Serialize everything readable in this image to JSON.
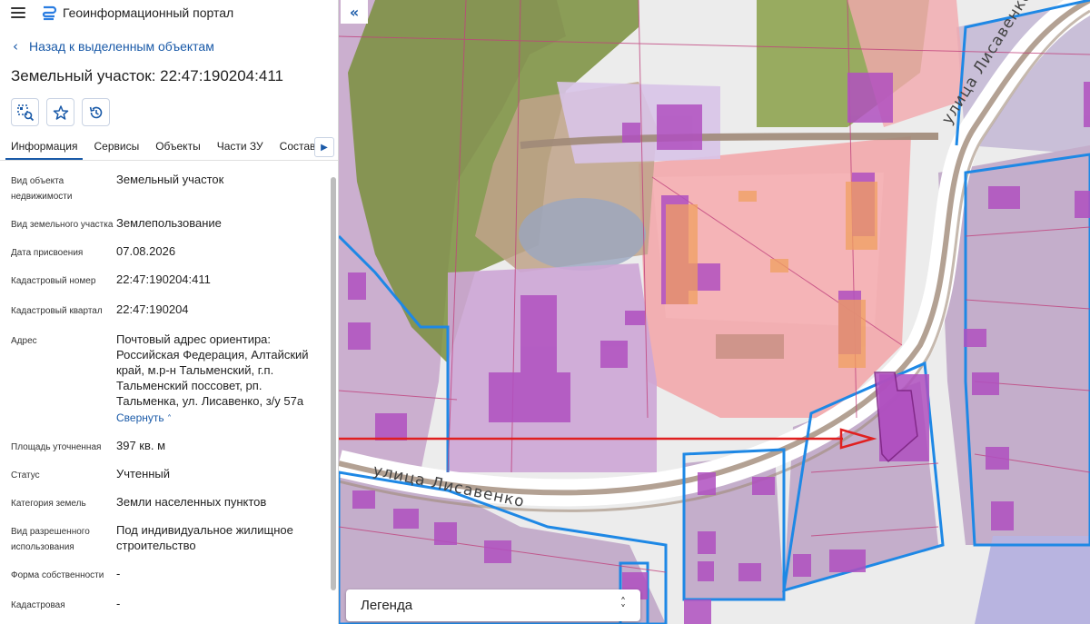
{
  "app": {
    "title": "Геоинформационный портал"
  },
  "nav": {
    "back_label": "Назад к выделенным объектам"
  },
  "object": {
    "title": "Земельный участок: 22:47:190204:411"
  },
  "actions": [
    {
      "name": "locate-icon"
    },
    {
      "name": "star-icon"
    },
    {
      "name": "history-icon"
    }
  ],
  "tabs": [
    {
      "label": "Информация",
      "active": true
    },
    {
      "label": "Сервисы"
    },
    {
      "label": "Объекты"
    },
    {
      "label": "Части ЗУ"
    },
    {
      "label": "Состав"
    }
  ],
  "properties": [
    {
      "key": "Вид объекта недвижимости",
      "value": "Земельный участок"
    },
    {
      "key": "Вид земельного участка",
      "value": "Землепользование"
    },
    {
      "key": "Дата присвоения",
      "value": "07.08.2026"
    },
    {
      "key": "Кадастровый номер",
      "value": "22:47:190204:411"
    },
    {
      "key": "Кадастровый квартал",
      "value": "22:47:190204"
    },
    {
      "key": "Адрес",
      "value": "Почтовый адрес ориентира: Российская Федерация, Алтайский край, м.р-н Тальменский, г.п. Тальменский поссовет, рп. Тальменка, ул. Лисавенко, з/у 57а",
      "link": "Свернуть"
    },
    {
      "key": "Площадь уточненная",
      "value": "397 кв. м"
    },
    {
      "key": "Статус",
      "value": "Учтенный"
    },
    {
      "key": "Категория земель",
      "value": "Земли населенных пунктов"
    },
    {
      "key": "Вид разрешенного использования",
      "value": "Под индивидуальное жилищное строительство"
    },
    {
      "key": "Форма собственности",
      "value": "-"
    },
    {
      "key": "Кадастровая",
      "value": "-"
    }
  ],
  "map": {
    "street_label_1": "улица Лисавенко",
    "street_label_2": "улица Лисавенко",
    "legend_label": "Легенда"
  },
  "colors": {
    "accent": "#1a5aa8",
    "parcel_blue": "#1e88e5",
    "building": "#b050c0",
    "arrow": "#e02020"
  }
}
